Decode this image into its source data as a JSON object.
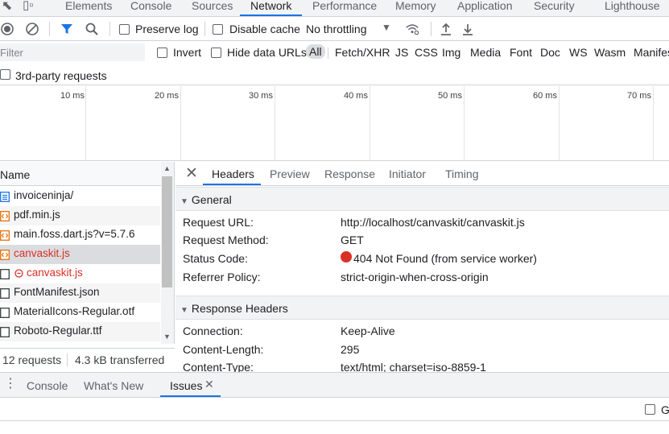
{
  "top_tabs": [
    {
      "label": "Elements"
    },
    {
      "label": "Console"
    },
    {
      "label": "Sources"
    },
    {
      "label": "Network",
      "active": true
    },
    {
      "label": "Performance"
    },
    {
      "label": "Memory"
    },
    {
      "label": "Application"
    },
    {
      "label": "Security"
    },
    {
      "label": "Lighthouse"
    }
  ],
  "toolbar": {
    "preserve_log": "Preserve log",
    "disable_cache": "Disable cache",
    "throttling": "No throttling"
  },
  "filter": {
    "placeholder": "Filter",
    "invert": "Invert",
    "hide_data_urls": "Hide data URLs",
    "types": [
      "All",
      "Fetch/XHR",
      "JS",
      "CSS",
      "Img",
      "Media",
      "Font",
      "Doc",
      "WS",
      "Wasm",
      "Manifes"
    ],
    "third_party": "3rd-party requests"
  },
  "timeline": {
    "ticks": [
      "10 ms",
      "20 ms",
      "30 ms",
      "40 ms",
      "50 ms",
      "60 ms",
      "70 ms"
    ]
  },
  "request_list": {
    "header": "Name",
    "requests": [
      {
        "name": "invoiceninja/",
        "icon": "document-icon",
        "status": "normal"
      },
      {
        "name": "pdf.min.js",
        "icon": "script-icon",
        "status": "normal"
      },
      {
        "name": "main.foss.dart.js?v=5.7.6",
        "icon": "script-icon",
        "status": "normal"
      },
      {
        "name": "canvaskit.js",
        "icon": "script-icon",
        "status": "error"
      },
      {
        "name": "canvaskit.js",
        "icon": "blocked-icon",
        "status": "error"
      },
      {
        "name": "FontManifest.json",
        "icon": "file-icon",
        "status": "normal"
      },
      {
        "name": "MaterialIcons-Regular.otf",
        "icon": "file-icon",
        "status": "normal"
      },
      {
        "name": "Roboto-Regular.ttf",
        "icon": "file-icon",
        "status": "normal"
      }
    ]
  },
  "status_bar": {
    "requests": "12 requests",
    "transferred": "4.3 kB transferred"
  },
  "details": {
    "tabs": [
      "Headers",
      "Preview",
      "Response",
      "Initiator",
      "Timing"
    ],
    "general_title": "General",
    "general": [
      {
        "key": "Request URL:",
        "value": "http://localhost/canvaskit/canvaskit.js"
      },
      {
        "key": "Request Method:",
        "value": "GET"
      },
      {
        "key": "Status Code:",
        "value": "404 Not Found (from service worker)",
        "status_color": "#d93025"
      },
      {
        "key": "Referrer Policy:",
        "value": "strict-origin-when-cross-origin"
      }
    ],
    "response_headers_title": "Response Headers",
    "response_headers": [
      {
        "key": "Connection:",
        "value": "Keep-Alive"
      },
      {
        "key": "Content-Length:",
        "value": "295"
      },
      {
        "key": "Content-Type:",
        "value": "text/html; charset=iso-8859-1"
      }
    ]
  },
  "drawer": {
    "tabs": [
      "Console",
      "What's New",
      "Issues"
    ]
  },
  "bottom": {
    "trailing_label": "G"
  },
  "colors": {
    "accent": "#1a73e8",
    "error": "#d93025",
    "script_icon": "#e8710a",
    "document_icon": "#1a73e8"
  }
}
